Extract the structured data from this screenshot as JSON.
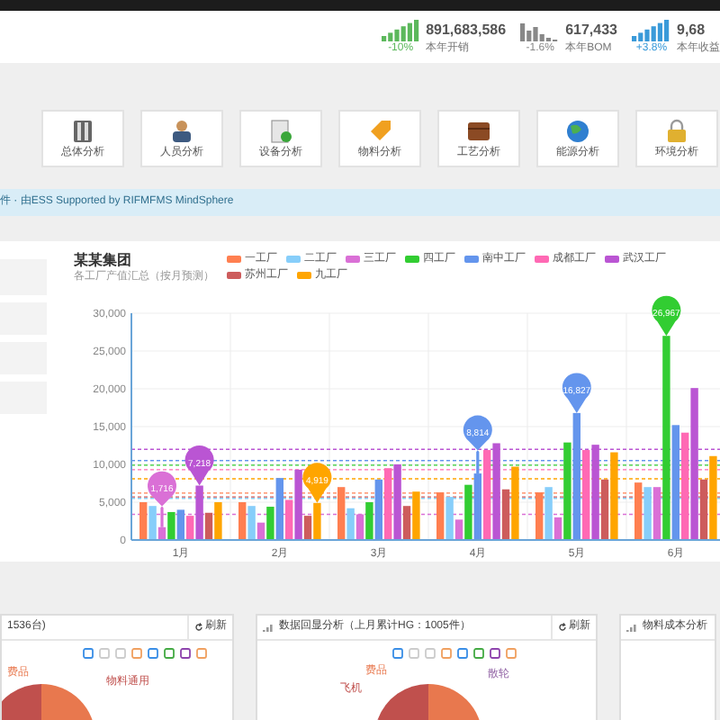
{
  "stats": [
    {
      "value": "891,683,586",
      "change": "-10%",
      "label": "本年开销",
      "color": "#5cb85c"
    },
    {
      "value": "617,433",
      "change": "-1.6%",
      "label": "本年BOM",
      "color": "#888888"
    },
    {
      "value": "9,68",
      "change": "+3.8%",
      "label": "本年收益",
      "color": "#3a9ad9"
    }
  ],
  "modules": [
    {
      "label": "总体分析"
    },
    {
      "label": "人员分析"
    },
    {
      "label": "设备分析"
    },
    {
      "label": "物料分析"
    },
    {
      "label": "工艺分析"
    },
    {
      "label": "能源分析"
    },
    {
      "label": "环境分析"
    }
  ],
  "notice": "件 · 由ESS Supported by RIFMFMS MindSphere",
  "chart": {
    "title": "某某集团",
    "subtitle": "各工厂产值汇总（按月预测）",
    "chart_data": {
      "type": "bar",
      "categories": [
        "1月",
        "2月",
        "3月",
        "4月",
        "5月",
        "6月"
      ],
      "ylim": [
        0,
        30000
      ],
      "grid": true,
      "yticks": [
        {
          "value": 0,
          "label": "0"
        },
        {
          "value": 5000,
          "label": "5,000"
        },
        {
          "value": 10000,
          "label": "10,000"
        },
        {
          "value": 15000,
          "label": "15,000"
        },
        {
          "value": 20000,
          "label": "20,000"
        },
        {
          "value": 25000,
          "label": "25,000"
        },
        {
          "value": 30000,
          "label": "30,000"
        }
      ],
      "series": [
        {
          "name": "一工厂",
          "color": "#ff7f50",
          "values": [
            5000,
            5000,
            7000,
            6300,
            6300,
            7600
          ]
        },
        {
          "name": "二工厂",
          "color": "#87cefa",
          "values": [
            4500,
            4500,
            4200,
            5700,
            7000,
            7000
          ]
        },
        {
          "name": "三工厂",
          "color": "#da70d6",
          "values": [
            1700,
            2300,
            3400,
            2700,
            3000,
            7000
          ]
        },
        {
          "name": "四工厂",
          "color": "#32cd32",
          "values": [
            3700,
            4400,
            5000,
            7300,
            12900,
            27000
          ]
        },
        {
          "name": "南中工厂",
          "color": "#6495ed",
          "values": [
            4000,
            8200,
            8000,
            8800,
            16800,
            15200
          ]
        },
        {
          "name": "成都工厂",
          "color": "#ff69b4",
          "values": [
            3200,
            5300,
            9500,
            11900,
            11900,
            14200
          ]
        },
        {
          "name": "武汉工厂",
          "color": "#ba55d3",
          "values": [
            7200,
            9300,
            10000,
            12800,
            12600,
            20100
          ]
        },
        {
          "name": "苏州工厂",
          "color": "#cd5c5c",
          "values": [
            3600,
            3200,
            4500,
            6700,
            8000,
            8000
          ]
        },
        {
          "name": "九工厂",
          "color": "#ffa500",
          "values": [
            5000,
            4900,
            6400,
            9700,
            11600,
            11100
          ]
        }
      ],
      "ref_lines": [
        {
          "axis": "y",
          "value": 6200,
          "color": "#ff7f50"
        },
        {
          "axis": "y",
          "value": 5500,
          "color": "#87cefa"
        },
        {
          "axis": "y",
          "value": 3400,
          "color": "#da70d6"
        },
        {
          "axis": "y",
          "value": 9900,
          "color": "#32cd32"
        },
        {
          "axis": "y",
          "value": 10500,
          "color": "#6495ed"
        },
        {
          "axis": "y",
          "value": 9300,
          "color": "#ff69b4"
        },
        {
          "axis": "y",
          "value": 12000,
          "color": "#ba55d3"
        },
        {
          "axis": "y",
          "value": 5700,
          "color": "#cd5c5c"
        },
        {
          "axis": "y",
          "value": 8100,
          "color": "#ffa500"
        }
      ],
      "annotations": [
        "1,716",
        {
          "text": "7,218",
          "x": "1月",
          "y": 7200
        },
        "4,919",
        "8,814",
        {
          "text": "16,827",
          "x": "5月",
          "y": 16800
        },
        {
          "text": "26,967",
          "x": "6月",
          "y": 27000
        }
      ]
    }
  },
  "panels": [
    {
      "title": "1536台)",
      "refresh": "刷新",
      "labels": [
        "费品",
        "物料通用"
      ]
    },
    {
      "title": "数据回显分析（上月累计HG：1005件）",
      "refresh": "刷新",
      "labels": [
        "费品",
        "飞机",
        "散轮"
      ]
    },
    {
      "title": "物料成本分析"
    }
  ]
}
